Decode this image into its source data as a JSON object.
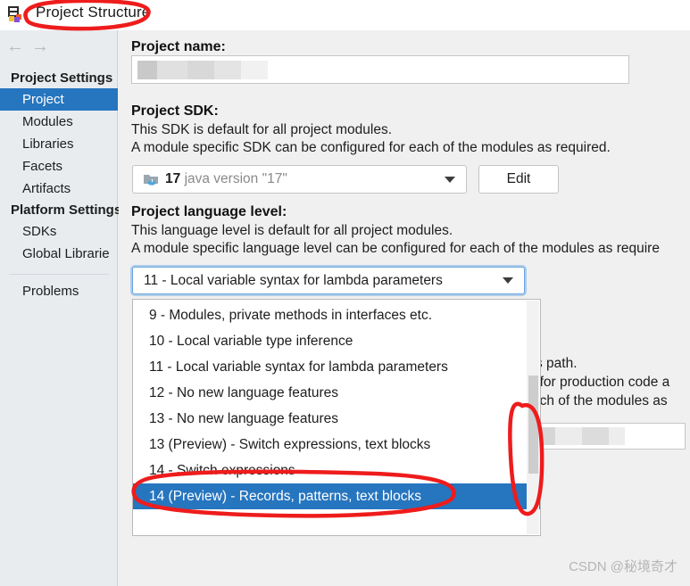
{
  "window": {
    "title": "Project Structure",
    "app_icon": "intellij-idea-icon"
  },
  "nav": {
    "back_icon": "arrow-left-icon",
    "forward_icon": "arrow-right-icon"
  },
  "sidebar": {
    "groups": [
      {
        "label": "Project Settings",
        "items": [
          {
            "label": "Project",
            "selected": true
          },
          {
            "label": "Modules",
            "selected": false
          },
          {
            "label": "Libraries",
            "selected": false
          },
          {
            "label": "Facets",
            "selected": false
          },
          {
            "label": "Artifacts",
            "selected": false
          }
        ]
      },
      {
        "label": "Platform Settings",
        "items": [
          {
            "label": "SDKs",
            "selected": false
          },
          {
            "label": "Global Librarie",
            "selected": false
          }
        ]
      }
    ],
    "footer_item": "Problems"
  },
  "main": {
    "project_name": {
      "label": "Project name:",
      "value": "",
      "redacted": true
    },
    "project_sdk": {
      "label": "Project SDK:",
      "desc_line1": "This SDK is default for all project modules.",
      "desc_line2": "A module specific SDK can be configured for each of the modules as required.",
      "selected_name": "17",
      "selected_version": "java version \"17\"",
      "icon": "java-sdk-folder-icon",
      "edit_button": "Edit"
    },
    "project_language_level": {
      "label": "Project language level:",
      "desc_line1": "This language level is default for all project modules.",
      "desc_line2": "A module specific language level can be configured for each of the modules as require",
      "selected": "11 - Local variable syntax for lambda parameters"
    },
    "occluded_text": {
      "line1": "s path.",
      "line2": "t for production code a",
      "line3": "ach of the modules as"
    }
  },
  "dropdown": {
    "open": true,
    "options": [
      {
        "label": "9 - Modules, private methods in interfaces etc.",
        "selected": false
      },
      {
        "label": "10 - Local variable type inference",
        "selected": false
      },
      {
        "label": "11 - Local variable syntax for lambda parameters",
        "selected": false
      },
      {
        "label": "12 - No new language features",
        "selected": false
      },
      {
        "label": "13 - No new language features",
        "selected": false
      },
      {
        "label": "13 (Preview) - Switch expressions, text blocks",
        "selected": false
      },
      {
        "label": "14 - Switch expressions",
        "selected": false
      },
      {
        "label": "14 (Preview) - Records, patterns, text blocks",
        "selected": true
      }
    ]
  },
  "annotations": {
    "color": "#ee1c1c",
    "marks": [
      "ellipse-around-title",
      "ellipse-around-scrollbar",
      "ellipse-around-selected-option"
    ]
  },
  "watermark": "CSDN @秘境奇才",
  "colors": {
    "selection_blue": "#2675bf",
    "sidebar_bg": "#e8ecef",
    "content_bg": "#f0f0f0",
    "focus_ring": "#aecdea",
    "annotation_red": "#ee1c1c"
  }
}
